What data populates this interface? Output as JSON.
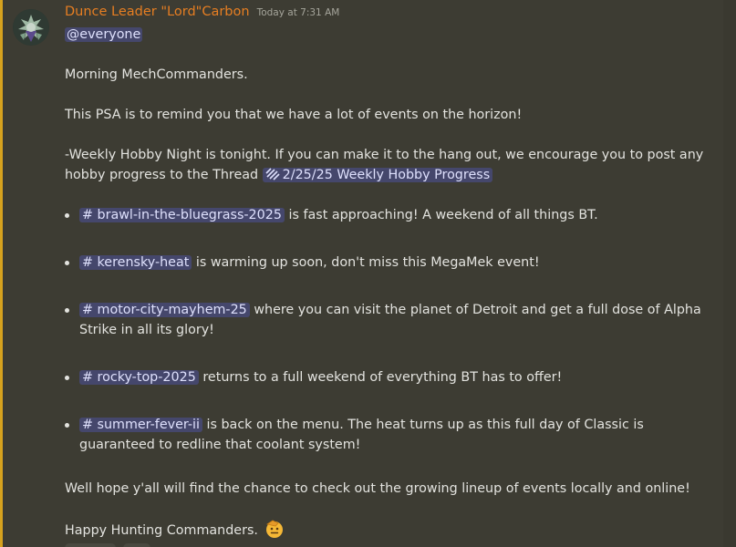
{
  "message": {
    "author": "Dunce Leader \"Lord\"Carbon",
    "timestamp": "Today at 7:31 AM",
    "mention": "@everyone",
    "greeting": "Morning MechCommanders.",
    "psa": "This PSA is to remind you that we have a lot of events on the horizon!",
    "hobby_line1": "-Weekly Hobby Night is tonight. If you can make it to the hang out, we encourage you to post any",
    "hobby_line2": "hobby progress to the Thread",
    "thread_name": "2/25/25 Weekly Hobby Progress",
    "events": [
      {
        "channel": "# brawl-in-the-bluegrass-2025",
        "text": " is fast approaching! A weekend of all things BT."
      },
      {
        "channel": "# kerensky-heat",
        "text": "is warming up soon, don't miss this MegaMek event!"
      },
      {
        "channel": "# motor-city-mayhem-25",
        "text": "where you can visit the planet of Detroit and get a full dose of Alpha",
        "text2": "Strike in all its glory!"
      },
      {
        "channel": "# rocky-top-2025",
        "text": "returns to a full weekend of everything BT has to offer!"
      },
      {
        "channel": "# summer-fever-ii",
        "text": "is back on the menu. The heat turns up as this full day of Classic is",
        "text2": "guaranteed to redline that coolant system!"
      }
    ],
    "closing": "Well hope y'all will find the chance to check out the growing lineup of events locally and online!",
    "signoff": "Happy Hunting Commanders."
  },
  "icons": {
    "thread": "thread-icon",
    "emoji": "saluting-face-icon",
    "avatar": "avatar-image"
  },
  "colors": {
    "background": "#3d3c33",
    "username": "#e67e22",
    "mention_bg": "#5865f2",
    "accent_bar": "#d6a21e"
  }
}
